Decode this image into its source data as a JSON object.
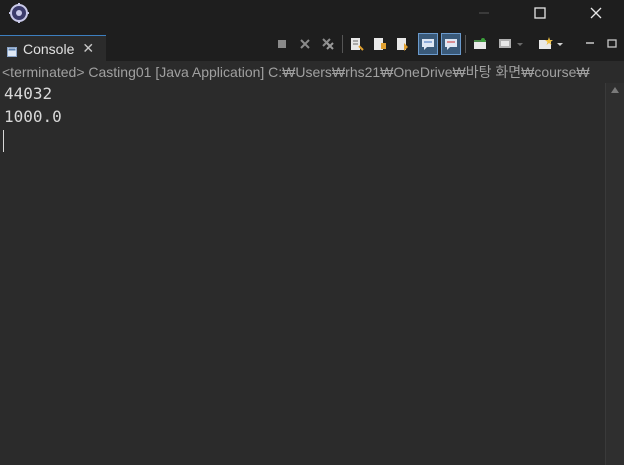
{
  "window": {
    "minimize_glyph": "—",
    "maximize_glyph": "☐",
    "close_glyph": "✕"
  },
  "tab": {
    "label": "Console",
    "close_glyph": "✕"
  },
  "toolbar": {
    "icons": [
      "stop-icon",
      "remove-launch-icon",
      "remove-all-terminated-icon",
      "clear-console-icon",
      "scroll-lock-icon",
      "word-wrap-icon",
      "show-console-on-stdout-icon",
      "show-console-on-stderr-icon",
      "pin-console-icon",
      "display-selected-console-icon",
      "open-console-icon",
      "view-menu-icon",
      "minimize-view-icon",
      "maximize-view-icon"
    ]
  },
  "console": {
    "status_line": "<terminated> Casting01 [Java Application] C:₩Users₩rhs21₩OneDrive₩바탕 화면₩course₩",
    "output": [
      "44032",
      "1000.0"
    ]
  }
}
